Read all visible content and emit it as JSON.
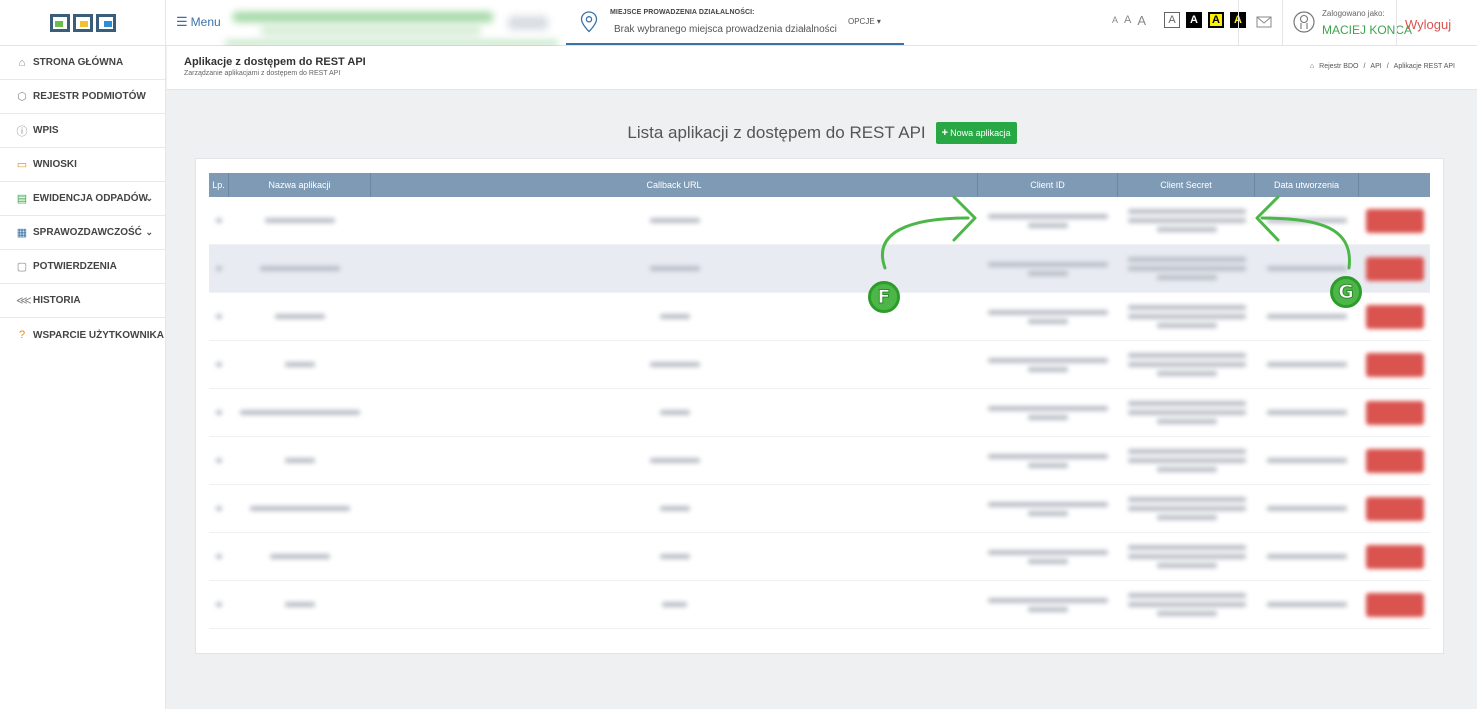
{
  "topbar": {
    "menu_label": "Menu",
    "place_label": "MIEJSCE PROWADZENIA DZIAŁALNOŚCI:",
    "place_value": "Brak wybranego miejsca prowadzenia działalności",
    "place_options": "OPCJE",
    "font_sizes": [
      "A",
      "A",
      "A"
    ],
    "contrast_options": [
      "A",
      "A",
      "A",
      "A"
    ],
    "logged_label": "Zalogowano jako:",
    "logged_user": "MACIEJ KONCA",
    "logout": "Wyloguj"
  },
  "sidebar": {
    "items": [
      {
        "label": "STRONA GŁÓWNA",
        "icon": "home-icon"
      },
      {
        "label": "REJESTR PODMIOTÓW",
        "icon": "cube-icon"
      },
      {
        "label": "WPIS",
        "icon": "info-icon"
      },
      {
        "label": "WNIOSKI",
        "icon": "briefcase-icon"
      },
      {
        "label": "EWIDENCJA ODPADÓW",
        "icon": "ledger-icon",
        "expandable": true
      },
      {
        "label": "SPRAWOZDAWCZOŚĆ",
        "icon": "clipboard-icon",
        "expandable": true
      },
      {
        "label": "POTWIERDZENIA",
        "icon": "square-icon"
      },
      {
        "label": "HISTORIA",
        "icon": "history-icon"
      },
      {
        "label": "WSPARCIE UŻYTKOWNIKA",
        "icon": "help-icon"
      }
    ]
  },
  "page": {
    "title": "Aplikacje z dostępem do REST API",
    "subtitle": "Zarządzanie aplikacjami z dostępem do REST API",
    "breadcrumb": [
      "Rejestr BDO",
      "API",
      "Aplikacje REST API"
    ],
    "breadcrumb_separator": "/"
  },
  "main": {
    "list_title": "Lista aplikacji z dostępem do REST API",
    "new_button": "Nowa aplikacja",
    "new_button_plus": "+",
    "columns": [
      "Lp.",
      "Nazwa aplikacji",
      "Callback URL",
      "Client ID",
      "Client Secret",
      "Data utworzenia",
      ""
    ],
    "row_count": 9
  },
  "annotations": {
    "marker_f": "F",
    "marker_g": "G",
    "marker_color": "#4cb748"
  },
  "colors": {
    "header_blue": "#7f9ab5",
    "accent_green": "#28a745",
    "delete_red": "#d9534f",
    "logout_red": "#d9534f",
    "link_blue": "#3a72a8"
  }
}
